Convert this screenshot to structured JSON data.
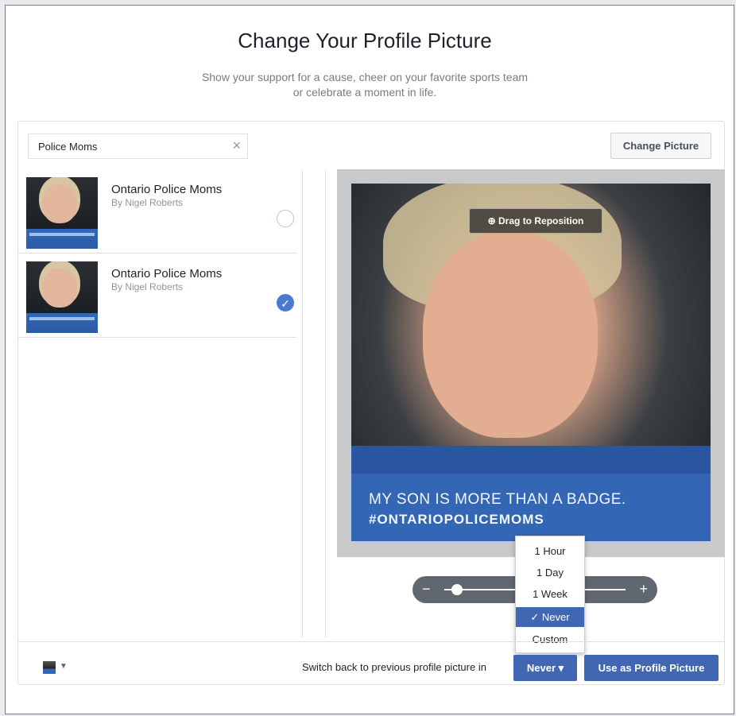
{
  "header": {
    "title": "Change Your Profile Picture",
    "subtitle": "Show your support for a cause, cheer on your favorite sports team or celebrate a moment in life."
  },
  "search": {
    "value": "Police Moms",
    "clear_icon": "close-icon"
  },
  "toolbar": {
    "change_picture_label": "Change Picture"
  },
  "frames": [
    {
      "title": "Ontario Police Moms",
      "author": "By Nigel Roberts",
      "selected": false
    },
    {
      "title": "Ontario Police Moms",
      "author": "By Nigel Roberts",
      "selected": true
    }
  ],
  "preview": {
    "drag_label": "Drag to Reposition",
    "caption_line1": "MY SON IS MORE THAN A BADGE.",
    "caption_line2": "#ONTARIOPOLICEMOMS"
  },
  "zoom": {
    "minus": "−",
    "plus": "+",
    "level": 0.05
  },
  "dropdown": {
    "options": [
      "1 Hour",
      "1 Day",
      "1 Week",
      "Never",
      "Custom"
    ],
    "selected": "Never"
  },
  "footer": {
    "switch_text": "Switch back to previous profile picture in",
    "never_label": "Never",
    "use_label": "Use as Profile Picture"
  },
  "colors": {
    "accent": "#4267b2",
    "caption_bg": "#3468b7"
  }
}
